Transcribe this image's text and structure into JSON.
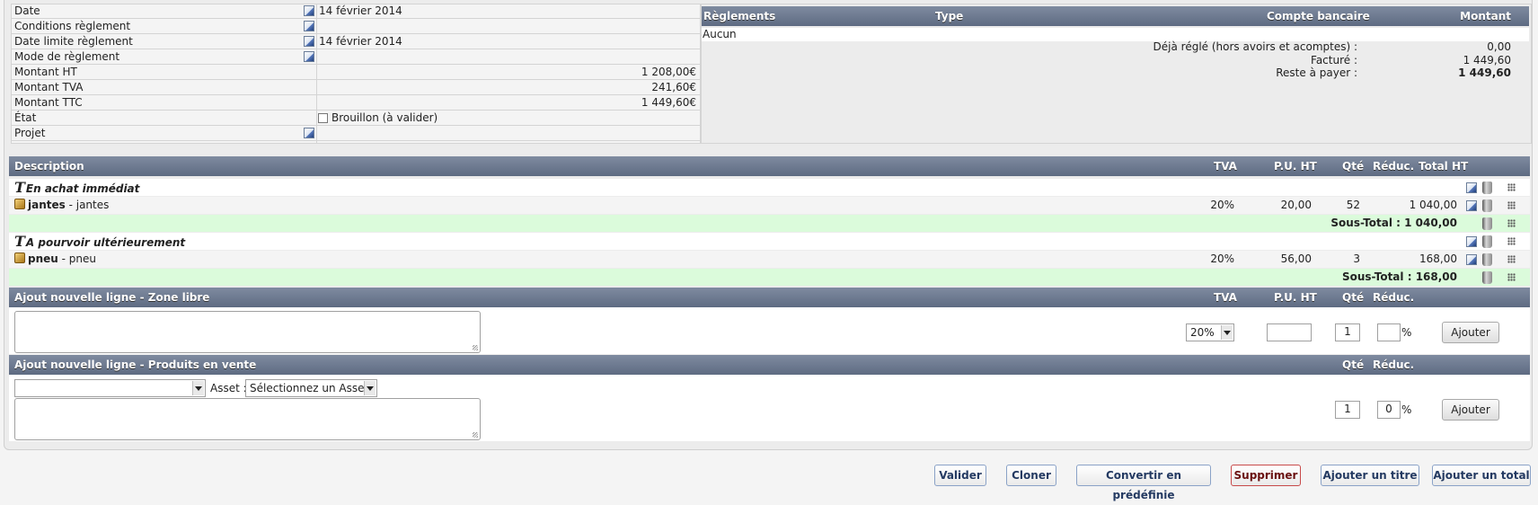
{
  "info": {
    "rows": [
      {
        "label": "Date",
        "value": "14 février 2014"
      },
      {
        "label": "Conditions règlement",
        "value": ""
      },
      {
        "label": "Date limite règlement",
        "value": "14 février 2014"
      },
      {
        "label": "Mode de règlement",
        "value": ""
      },
      {
        "label": "Montant HT",
        "value": "1 208,00€"
      },
      {
        "label": "Montant TVA",
        "value": "241,60€"
      },
      {
        "label": "Montant TTC",
        "value": "1 449,60€"
      },
      {
        "label": "État",
        "value": "Brouillon (à valider)"
      },
      {
        "label": "Projet",
        "value": ""
      }
    ]
  },
  "payments": {
    "headers": {
      "reglements": "Règlements",
      "type": "Type",
      "compte": "Compte bancaire",
      "montant": "Montant"
    },
    "none": "Aucun",
    "summary": [
      {
        "label": "Déjà réglé (hors avoirs et acomptes) :",
        "value": "0,00"
      },
      {
        "label": "Facturé :",
        "value": "1 449,60"
      },
      {
        "label": "Reste à payer :",
        "value": "1 449,60"
      }
    ]
  },
  "lines": {
    "headers": {
      "description": "Description",
      "tva": "TVA",
      "pu": "P.U. HT",
      "qte": "Qté",
      "reduc": "Réduc.",
      "total": "Total HT"
    },
    "title1": "En achat immédiat",
    "product1": {
      "ref": "jantes",
      "label": " - jantes",
      "tva": "20%",
      "pu": "20,00",
      "qte": "52",
      "total": "1 040,00"
    },
    "subtotal1": {
      "label": "Sous-Total :",
      "value": "1 040,00"
    },
    "title2": "A pourvoir ultérieurement",
    "product2": {
      "ref": "pneu",
      "label": " - pneu",
      "tva": "20%",
      "pu": "56,00",
      "qte": "3",
      "total": "168,00"
    },
    "subtotal2": {
      "label": "Sous-Total :",
      "value": "168,00"
    }
  },
  "add_free": {
    "header": "Ajout nouvelle ligne - Zone libre",
    "tva_header": "TVA",
    "pu_header": "P.U. HT",
    "qte_header": "Qté",
    "reduc_header": "Réduc.",
    "tva_value": "20%",
    "qte_value": "1",
    "percent": "%",
    "button": "Ajouter"
  },
  "add_product": {
    "header": "Ajout nouvelle ligne - Produits en vente",
    "qte_header": "Qté",
    "reduc_header": "Réduc.",
    "asset_label": "Asset :",
    "asset_select": "Sélectionnez un Asset",
    "qte_value": "1",
    "reduc_value": "0",
    "percent": "%",
    "button": "Ajouter"
  },
  "actions": {
    "valider": "Valider",
    "cloner": "Cloner",
    "convertir": "Convertir en prédéfinie",
    "supprimer": "Supprimer",
    "ajouter_titre": "Ajouter un titre",
    "ajouter_total": "Ajouter un total"
  }
}
